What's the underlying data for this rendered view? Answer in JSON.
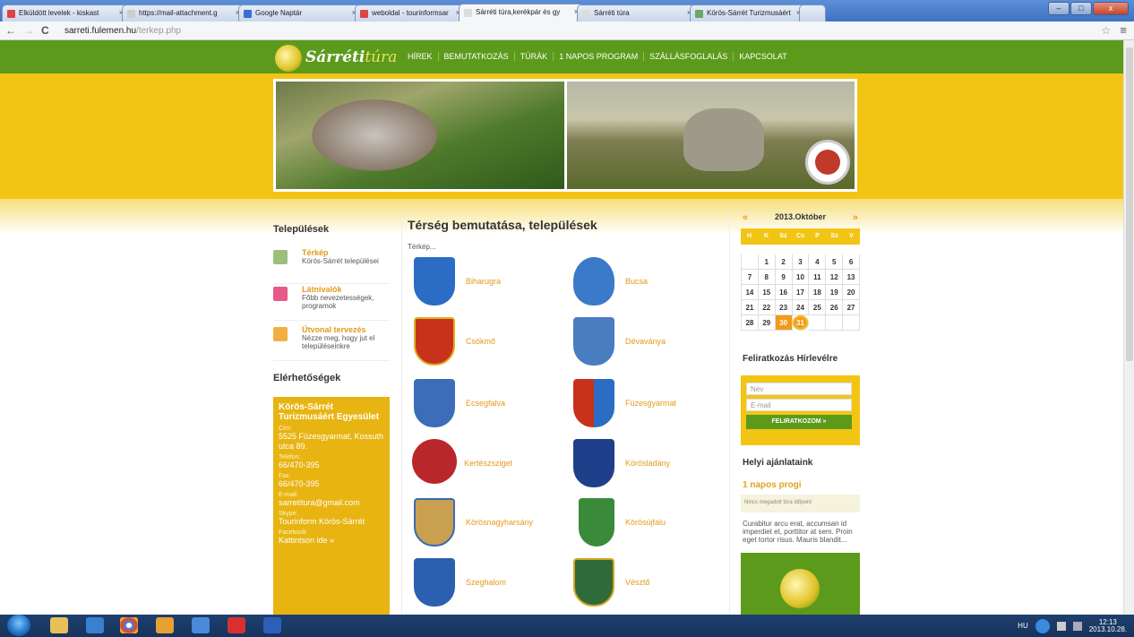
{
  "browser": {
    "tabs": [
      {
        "label": "Elküldött levelek - kiskast",
        "active": false
      },
      {
        "label": "https://mail-attachment.g",
        "active": false
      },
      {
        "label": "Google Naptár",
        "active": false
      },
      {
        "label": "weboldal - tourinformsar",
        "active": false
      },
      {
        "label": "Sárréti túra,kerékpár és gy",
        "active": true
      },
      {
        "label": "Sárréti túra",
        "active": false
      },
      {
        "label": "Körös-Sárrét Turizmusáért",
        "active": false
      }
    ],
    "url_domain": "sarreti.fulemen.hu",
    "url_path": "/terkep.php",
    "tab_close": "×",
    "back": "←",
    "forward": "→",
    "reload": "C",
    "star": "☆",
    "menu": "≡",
    "win_min": "–",
    "win_max": "□",
    "win_close": "x"
  },
  "site": {
    "logo_main": "Sárréti",
    "logo_script": "túra",
    "nav": [
      "HÍREK",
      "BEMUTATKOZÁS",
      "TÚRÁK",
      "1 NAPOS PROGRAM",
      "SZÁLLÁSFOGLALÁS",
      "KAPCSOLAT"
    ]
  },
  "left": {
    "settlements_title": "Települések",
    "items": [
      {
        "title": "Térkép",
        "desc": "Körös-Sárrét települései",
        "icon": "map-icon"
      },
      {
        "title": "Látnivalók",
        "desc": "Főbb nevezetességek, programok",
        "icon": "sights-icon"
      },
      {
        "title": "Útvonal tervezés",
        "desc": "Nézze meg, hogy jut el településeinkre",
        "icon": "route-icon"
      }
    ],
    "contacts_title": "Elérhetőségek",
    "org": "Körös-Sárrét Turizmusáért Egyesület",
    "address_label": "Cím:",
    "address": "5525 Füzesgyarmat, Kossuth utca 89.",
    "phone_label": "Telefon:",
    "phone": "66/470-395",
    "fax_label": "Fax:",
    "fax": "66/470-395",
    "email_label": "E-mail:",
    "email": "sarretitura@gmail.com",
    "skype_label": "Skype:",
    "skype": "Tourinform Körös-Sárrét",
    "facebook_label": "Facebook:",
    "facebook": "Kattintson ide »"
  },
  "main": {
    "title": "Térség bemutatása, települések",
    "breadcrumb": "Térkép...",
    "towns": [
      "Biharugra",
      "Bucsa",
      "Csökmő",
      "Dévaványa",
      "Ecsegfalva",
      "Füzesgyarmat",
      "Kertészsziget",
      "Körösladány",
      "Körösnagyharsány",
      "Körösújfalu",
      "Szeghalom",
      "Vésztő"
    ]
  },
  "calendar": {
    "prev": "«",
    "next": "»",
    "title": "2013.Október",
    "dow": [
      "H",
      "K",
      "Sz",
      "Cs",
      "P",
      "Sz",
      "V"
    ],
    "days": [
      "",
      "1",
      "2",
      "3",
      "4",
      "5",
      "6",
      "7",
      "8",
      "9",
      "10",
      "11",
      "12",
      "13",
      "14",
      "15",
      "16",
      "17",
      "18",
      "19",
      "20",
      "21",
      "22",
      "23",
      "24",
      "25",
      "26",
      "27",
      "28",
      "29",
      "30",
      "31",
      "",
      "",
      ""
    ],
    "highlight": "30",
    "today": "31"
  },
  "right": {
    "subscribe_title": "Feliratkozás Hírlevélre",
    "name_placeholder": "Név",
    "email_placeholder": "E-mail",
    "subscribe_button": "FELIRATKOZOM »",
    "offers_title": "Helyi ajánlataink",
    "progi_title": "1 napos progi",
    "no_date": "Nincs megadott túra időpont",
    "lorem": "Curabitur arcu erat, accumsan id imperdiet et, porttitor at sem. Proin eget tortor risus. Mauris blandit..."
  },
  "taskbar": {
    "lang": "HU",
    "time": "12:13",
    "date": "2013.10.28."
  },
  "colors": {
    "green": "#5c9a1c",
    "yellow": "#f2c515",
    "orange": "#e39a1a"
  }
}
